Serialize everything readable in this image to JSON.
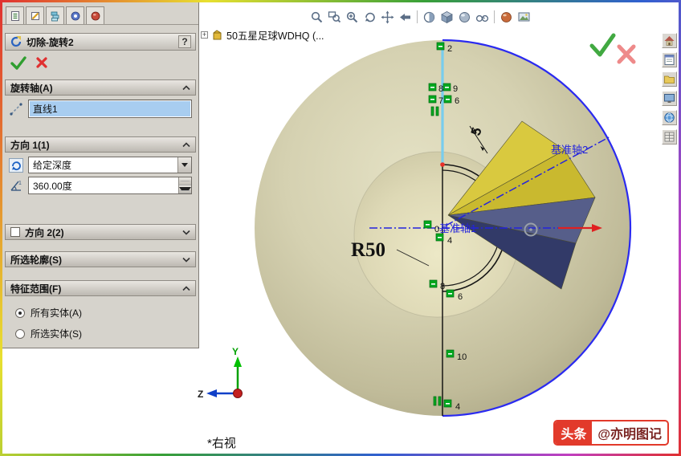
{
  "colors": {
    "panel_bg": "#d6d3cc",
    "selection_blue": "#a8cdf0",
    "sphere_base": "#cfcaa8",
    "sketch_selected_cyan": "#78cdee",
    "axis_blue": "#2323dd",
    "marker_green": "#00a81e",
    "confirm_green": "#41a941",
    "cancel_red": "#ee8a8a",
    "watermark_red": "#e23a2b"
  },
  "panel": {
    "tabs": [
      "propertymanager-tab",
      "appearance-tab",
      "configurationmanager-tab",
      "dimxpert-tab",
      "office-tab"
    ],
    "title": {
      "text": "切除-旋转2",
      "help": "?"
    },
    "sections": [
      {
        "label": "旋转轴(A)",
        "expanded": true,
        "value": "直线1"
      },
      {
        "label": "方向 1(1)",
        "expanded": true,
        "end_condition": "给定深度",
        "angle": "360.00度"
      },
      {
        "label": "方向 2(2)",
        "expanded": false
      },
      {
        "label": "所选轮廓(S)",
        "expanded": false
      },
      {
        "label": "特征范围(F)",
        "expanded": true,
        "options": [
          {
            "label": "所有实体(A)",
            "selected": true
          },
          {
            "label": "所选实体(S)",
            "selected": false
          }
        ]
      }
    ]
  },
  "viewport": {
    "tree_item": "50五星足球WDHQ (...",
    "toolbar_icons": [
      "zoom-to-fit",
      "zoom-to-area",
      "zoom-in-out",
      "rotate-view",
      "pan",
      "previous-view",
      "section-view",
      "view-orientation",
      "display-style",
      "hide-show-items",
      "edit-appearance",
      "apply-scene"
    ],
    "right_toolbar_icons": [
      "home",
      "document-pane",
      "folder",
      "task-pane",
      "appearance-globe",
      "custom-properties"
    ],
    "annotations": {
      "radius": "R50",
      "gap": "5",
      "axis1": "基准轴1",
      "axis2": "基准轴2"
    },
    "markers": [
      "2",
      "8",
      "9",
      "7",
      "6",
      "0",
      "4",
      "8",
      "6",
      "10",
      "4"
    ],
    "triad": {
      "y": "Y",
      "z": "Z"
    },
    "view_label": "*右视",
    "watermark": {
      "badge": "头条",
      "handle": "@亦明图记"
    }
  }
}
